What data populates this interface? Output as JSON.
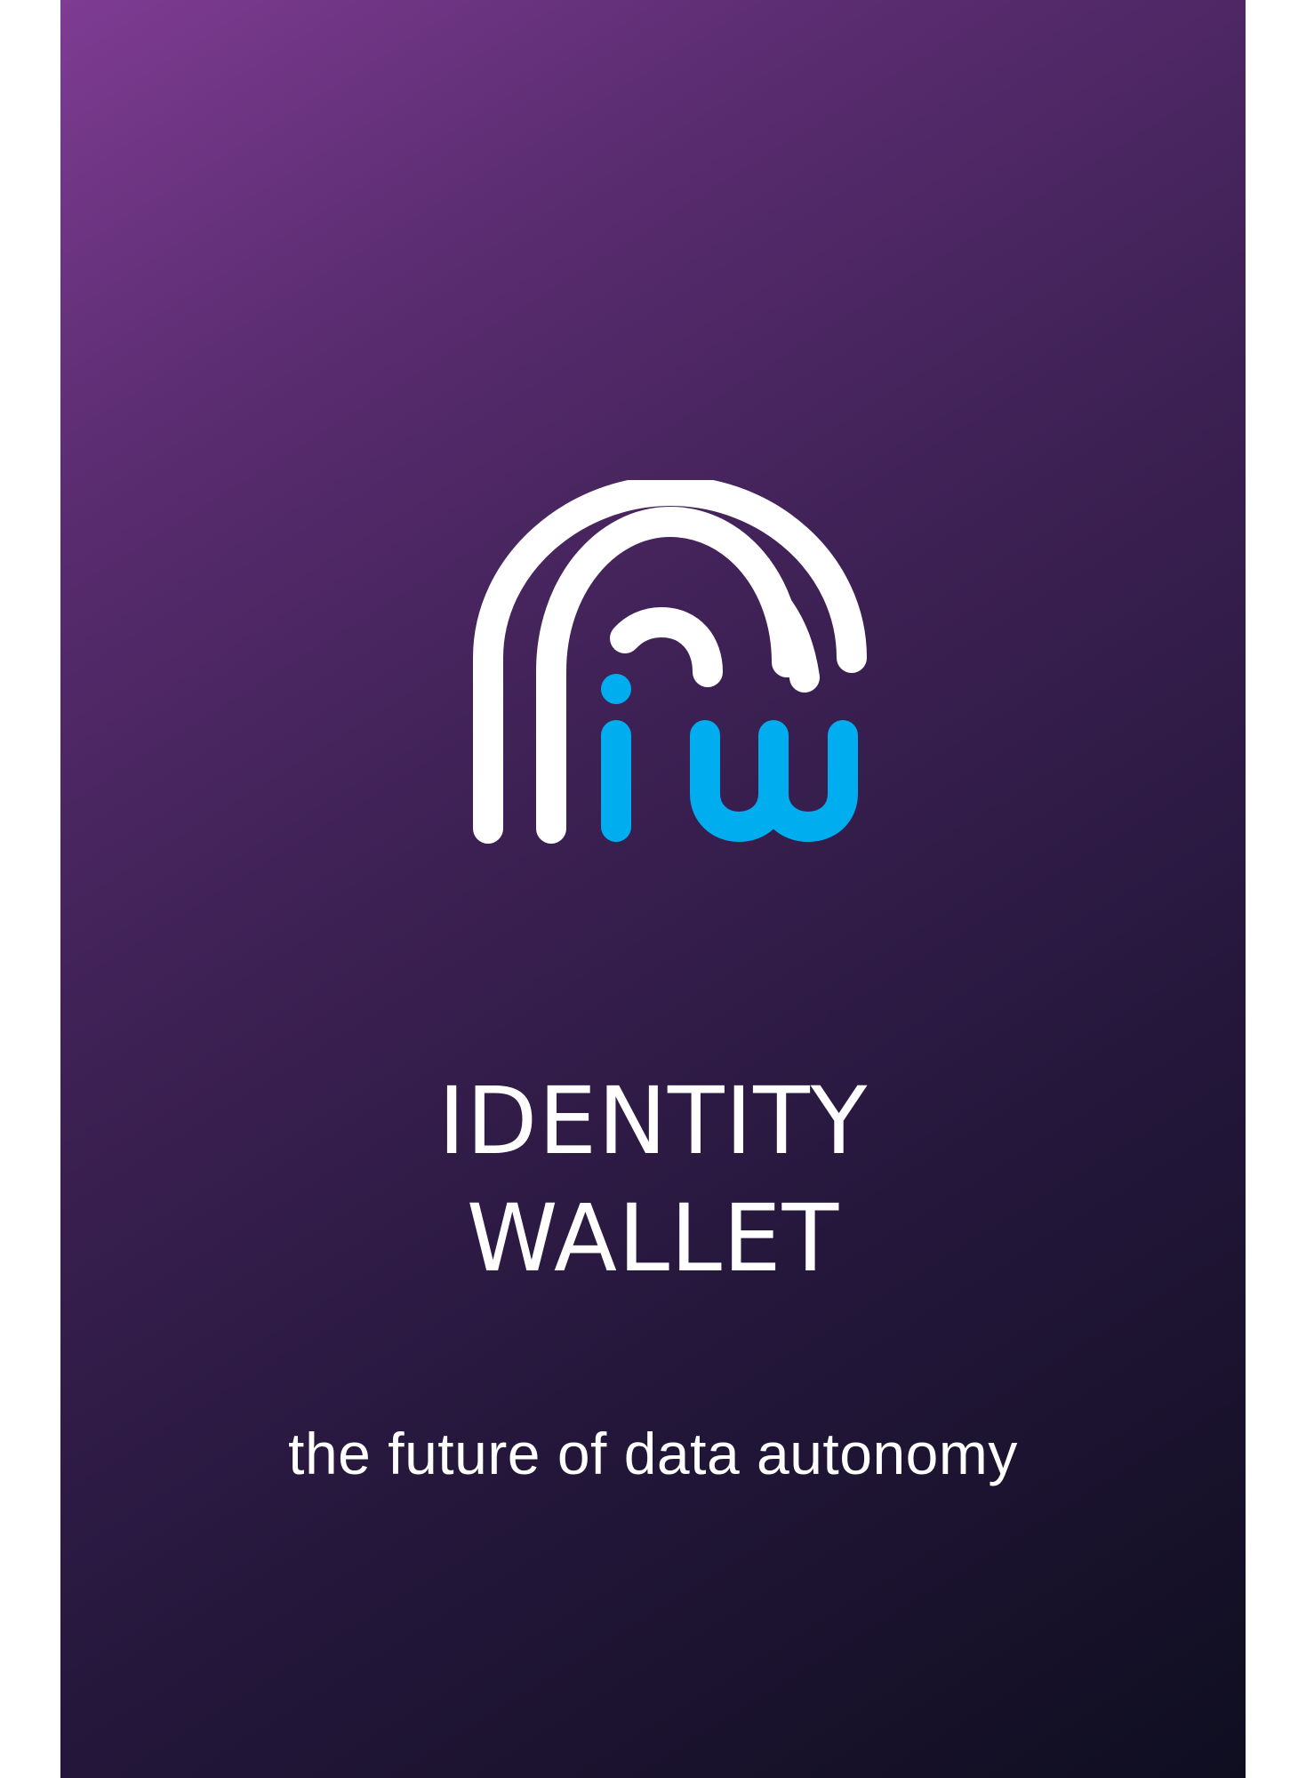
{
  "app": {
    "title_line1": "IDENTITY",
    "title_line2": "WALLET",
    "tagline": "the future of data autonomy"
  },
  "logo": {
    "icon": "identity-wallet-fingerprint-logo-icon",
    "letters": "iw",
    "arc_color": "#ffffff",
    "letter_color": "#00aeef"
  },
  "colors": {
    "background_gradient_start": "#7e3c92",
    "background_gradient_end": "#0f0e20",
    "text": "#ffffff",
    "accent": "#00aeef"
  }
}
